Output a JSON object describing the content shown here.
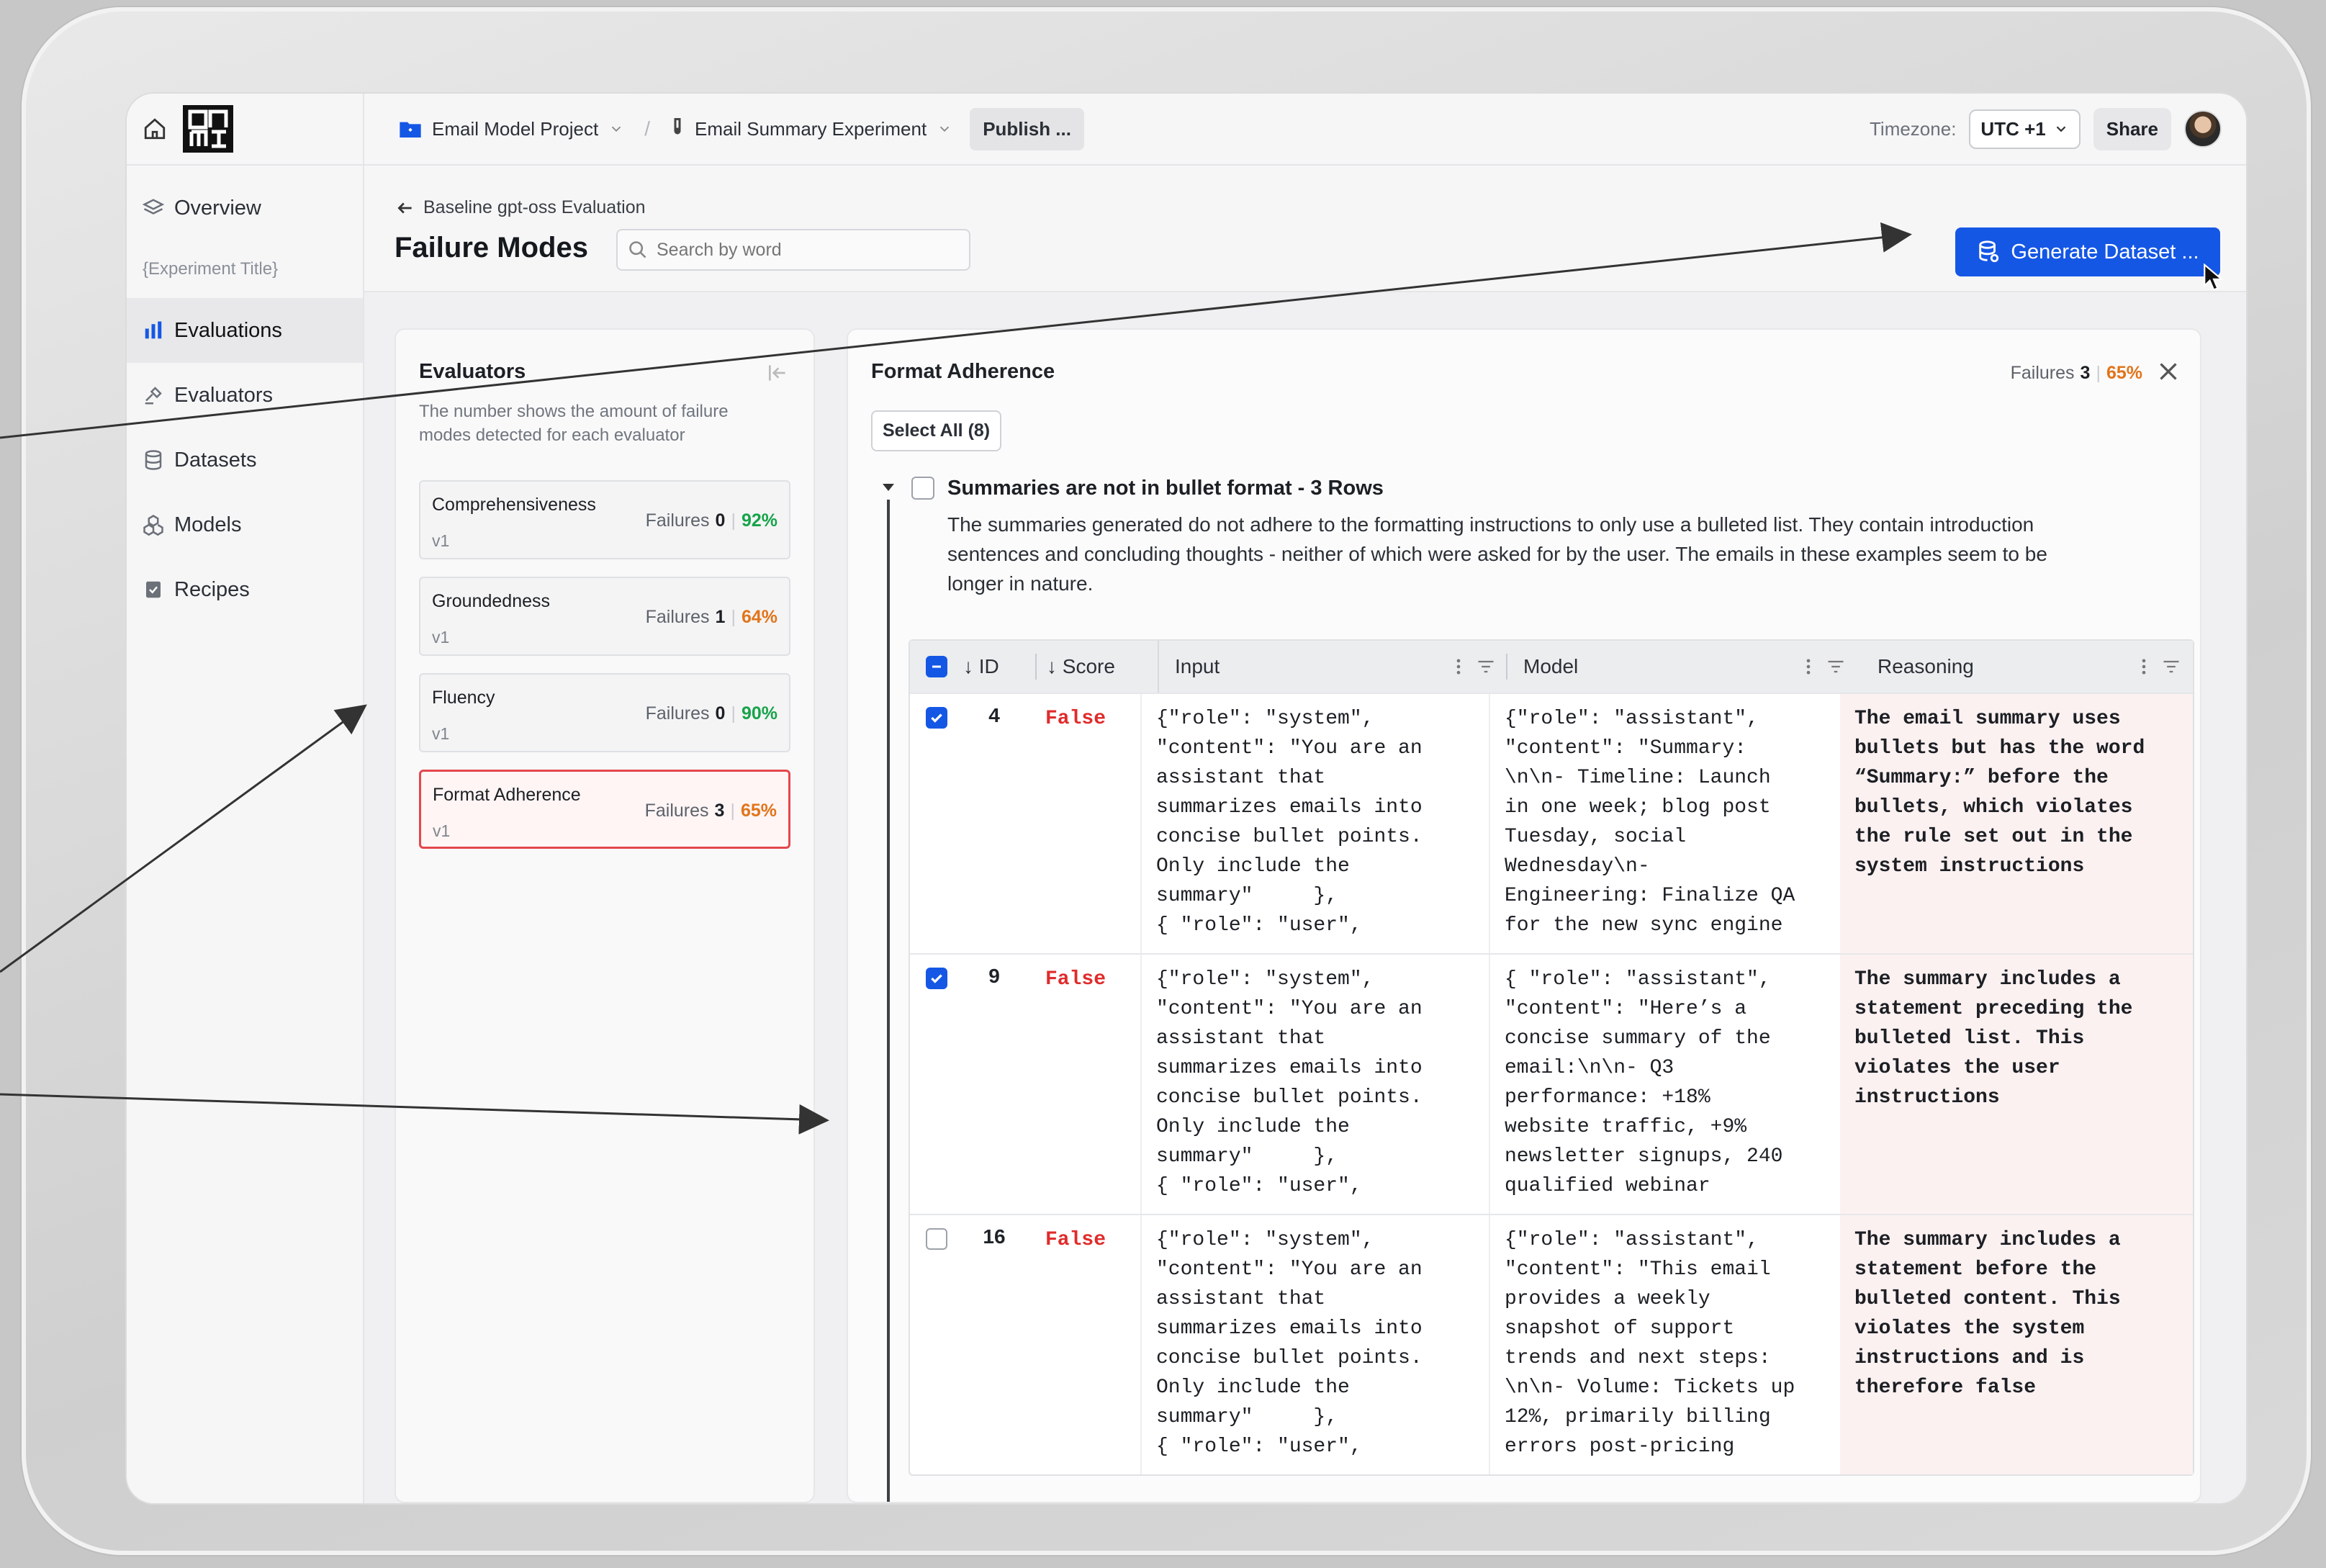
{
  "nav": {
    "logo_text": "DU\nMI",
    "items": [
      {
        "label": "Overview",
        "icon": "layers-icon"
      },
      {
        "label": "Evaluations",
        "icon": "bar-chart-icon"
      },
      {
        "label": "Evaluators",
        "icon": "gavel-icon"
      },
      {
        "label": "Datasets",
        "icon": "database-icon"
      },
      {
        "label": "Models",
        "icon": "cubes-icon"
      },
      {
        "label": "Recipes",
        "icon": "recipe-icon"
      }
    ],
    "experiment_placeholder": "{Experiment Title}"
  },
  "topbar": {
    "project": "Email Model Project",
    "experiment": "Email Summary Experiment",
    "publish_label": "Publish ...",
    "timezone_label": "Timezone:",
    "timezone_value": "UTC +1",
    "share_label": "Share"
  },
  "header": {
    "back_label": "Baseline gpt-oss Evaluation",
    "title": "Failure Modes",
    "search_placeholder": "Search by word",
    "generate_label": "Generate Dataset ..."
  },
  "evaluators": {
    "title": "Evaluators",
    "description": "The number shows the amount of failure modes detected for each evaluator",
    "failures_label": "Failures",
    "items": [
      {
        "name": "Comprehensiveness",
        "version": "v1",
        "failures": "0",
        "pct": "92%"
      },
      {
        "name": "Groundedness",
        "version": "v1",
        "failures": "1",
        "pct": "64%"
      },
      {
        "name": "Fluency",
        "version": "v1",
        "failures": "0",
        "pct": "90%"
      },
      {
        "name": "Format Adherence",
        "version": "v1",
        "failures": "3",
        "pct": "65%"
      }
    ]
  },
  "format_adherence": {
    "title": "Format Adherence",
    "failures_label": "Failures",
    "failures": "3",
    "pct": "65%",
    "select_all_label": "Select All (8)",
    "group_title": "Summaries are not in bullet format - 3 Rows",
    "group_desc": "The summaries generated do not adhere to the formatting instructions to only use a bulleted list. They contain introduction sentences and concluding thoughts - neither of which were asked for by the user. The emails in these examples seem to be longer in nature.",
    "columns": {
      "id": "↓ ID",
      "score": "↓ Score",
      "input": "Input",
      "model": "Model",
      "reasoning": "Reasoning"
    },
    "rows": [
      {
        "id": "4",
        "score": "False",
        "checked": true,
        "input": "{\"role\": \"system\",\n\"content\": \"You are an\nassistant that\nsummarizes emails into\nconcise bullet points.\nOnly include the\nsummary\"     },\n{ \"role\": \"user\",",
        "model": "{\"role\": \"assistant\",\n\"content\": \"Summary:\n\\n\\n- Timeline: Launch\nin one week; blog post\nTuesday, social\nWednesday\\n-\nEngineering: Finalize QA\nfor the new sync engine",
        "reasoning": "The email summary uses\nbullets but has the word\n“Summary:” before the\nbullets, which violates\nthe rule set out in the\nsystem instructions"
      },
      {
        "id": "9",
        "score": "False",
        "checked": true,
        "input": "{\"role\": \"system\",\n\"content\": \"You are an\nassistant that\nsummarizes emails into\nconcise bullet points.\nOnly include the\nsummary\"     },\n{ \"role\": \"user\",",
        "model": "{ \"role\": \"assistant\",\n\"content\": \"Here’s a\nconcise summary of the\nemail:\\n\\n- Q3\nperformance: +18%\nwebsite traffic, +9%\nnewsletter signups, 240\nqualified webinar",
        "reasoning": "The summary includes a\nstatement preceding the\nbulleted list. This\nviolates the user\ninstructions"
      },
      {
        "id": "16",
        "score": "False",
        "checked": false,
        "input": "{\"role\": \"system\",\n\"content\": \"You are an\nassistant that\nsummarizes emails into\nconcise bullet points.\nOnly include the\nsummary\"     },\n{ \"role\": \"user\",",
        "model": "{\"role\": \"assistant\",\n\"content\": \"This email\nprovides a weekly\nsnapshot of support\ntrends and next steps:\n\\n\\n- Volume: Tickets up\n12%, primarily billing\nerrors post-pricing",
        "reasoning": "The summary includes a\nstatement before the\nbulleted content. This\nviolates the system\ninstructions and is\ntherefore false"
      }
    ]
  },
  "colors": {
    "accent": "#1557e5",
    "danger": "#e02b2b",
    "green": "#16a34a",
    "orange": "#e2741a",
    "selected_border": "#e4474d"
  }
}
